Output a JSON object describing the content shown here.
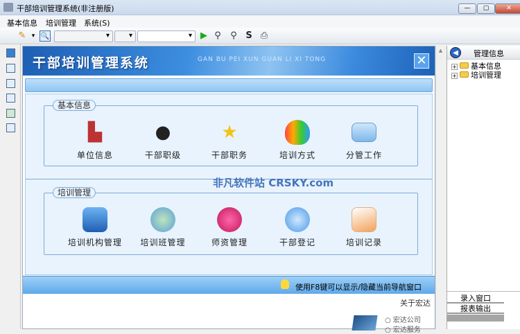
{
  "window": {
    "title": "干部培训管理系统(非注册版)",
    "buttons": [
      "minimize",
      "maximize",
      "close"
    ]
  },
  "menu": [
    "基本信息",
    "培训管理",
    "系统(S)"
  ],
  "toolbar": {
    "combo1": "",
    "combo2": "",
    "combo3": "",
    "icons": [
      "pencil-icon",
      "preview-icon",
      "run-icon",
      "find-user-icon",
      "find-user-minus-icon",
      "refresh-icon",
      "print-icon"
    ]
  },
  "banner": {
    "title": "干部培训管理系统",
    "pinyin": "GAN BU PEI XUN GUAN LI XI TONG"
  },
  "groups": [
    {
      "label": "基本信息",
      "items": [
        {
          "label": "单位信息",
          "icon": "building-icon"
        },
        {
          "label": "干部职级",
          "icon": "users-icon"
        },
        {
          "label": "干部职务",
          "icon": "star-icon"
        },
        {
          "label": "培训方式",
          "icon": "butterfly-icon"
        },
        {
          "label": "分管工作",
          "icon": "monitor-icon"
        }
      ]
    },
    {
      "label": "培训管理",
      "items": [
        {
          "label": "培训机构管理",
          "icon": "finder-icon"
        },
        {
          "label": "培训班管理",
          "icon": "class-icon"
        },
        {
          "label": "师资管理",
          "icon": "teachers-icon"
        },
        {
          "label": "干部登记",
          "icon": "group-icon"
        },
        {
          "label": "培训记录",
          "icon": "notes-icon"
        }
      ]
    }
  ],
  "tip": "使用F8键可以显示/隐藏当前导航窗口",
  "about": {
    "title": "关于宏达",
    "links": [
      "宏达公司",
      "宏达服务"
    ]
  },
  "watermark": "非凡软件站 CRSKY.com",
  "right_panel": {
    "title": "管理信息",
    "tree": [
      "基本信息",
      "培训管理"
    ],
    "buttons": [
      "录入窗口",
      "报表输出"
    ]
  }
}
